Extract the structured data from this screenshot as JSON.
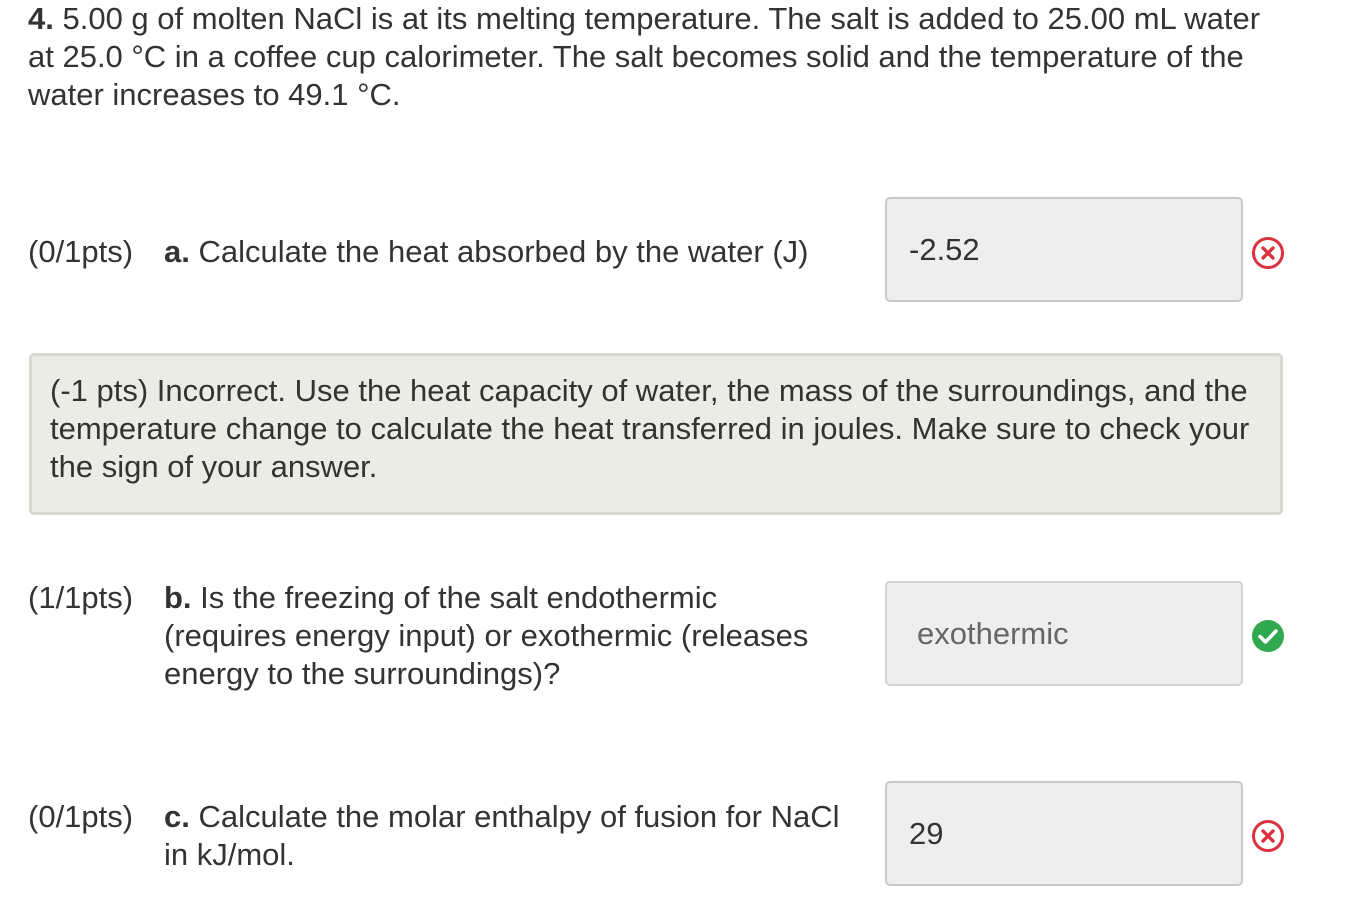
{
  "question": {
    "number": "4.",
    "text": " 5.00 g of molten NaCl is at its melting temperature. The salt is added to 25.00 mL water at 25.0 °C in a coffee cup calorimeter. The salt becomes solid and the temperature of the water increases to 49.1 °C."
  },
  "parts": [
    {
      "points": "(0/1pts)",
      "letter": "a.",
      "text": " Calculate the heat absorbed by the water (J)",
      "answer": "-2.52",
      "status": "incorrect"
    },
    {
      "points": "(1/1pts)",
      "letter": "b.",
      "text": " Is the freezing of the salt endothermic (requires energy input) or exothermic (releases energy to the surroundings)?",
      "answer": "exothermic",
      "status": "correct"
    },
    {
      "points": "(0/1pts)",
      "letter": "c.",
      "text": " Calculate the molar enthalpy of fusion for NaCl in kJ/mol.",
      "answer": "29",
      "status": "incorrect"
    }
  ],
  "feedback": {
    "text": "(-1 pts) Incorrect. Use the heat capacity of water, the mass of the surroundings, and the temperature change to calculate the heat transferred in joules. Make sure to check your the sign of your answer."
  },
  "icons": {
    "incorrect": "x-circle-icon",
    "correct": "check-circle-icon"
  },
  "colors": {
    "incorrect": "#d9333f",
    "correct": "#2fa84f",
    "feedback_bg": "#ecece7",
    "input_bg": "#eeeeee"
  }
}
